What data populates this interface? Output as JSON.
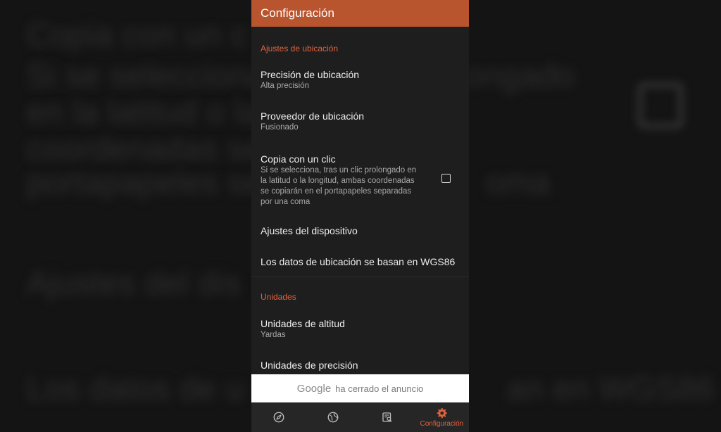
{
  "appbar": {
    "title": "Configuración"
  },
  "sections": {
    "location": {
      "header": "Ajustes de ubicación",
      "precision": {
        "title": "Precisión de ubicación",
        "summary": "Alta precisión"
      },
      "provider": {
        "title": "Proveedor de ubicación",
        "summary": "Fusionado"
      },
      "one_click_copy": {
        "title": "Copia con un clic",
        "summary": "Si se selecciona, tras un clic prolongado en la latitud o la longitud, ambas coordenadas se copiarán en el portapapeles separadas por una coma",
        "checked": false
      },
      "device_settings": {
        "title": "Ajustes del dispositivo"
      },
      "wgs": {
        "title": "Los datos de ubicación se basan en WGS86"
      }
    },
    "units": {
      "header": "Unidades",
      "altitude": {
        "title": "Unidades de altitud",
        "summary": "Yardas"
      },
      "precision_units": {
        "title": "Unidades de precisión"
      }
    }
  },
  "ad_banner": {
    "brand": "Google",
    "text": "ha cerrado el anuncio"
  },
  "navbar": {
    "tabs": [
      {
        "icon": "compass-icon"
      },
      {
        "icon": "globe-icon"
      },
      {
        "icon": "log-search-icon"
      },
      {
        "icon": "gear-icon",
        "label": "Configuración",
        "active": true
      }
    ]
  },
  "background_echo": {
    "line1": "Copia con un c",
    "line2": "Si se selecciona,",
    "line2b": "ongado",
    "line3": "en la latitud o la l",
    "line4": "coordenadas se c",
    "line5": "portapapeles sep",
    "line5b": "oma",
    "line6": "Ajustes del dis",
    "line7": "Los datos de u",
    "line7b": "an en WGS86"
  },
  "colors": {
    "accent": "#e0623f",
    "appbar": "#b8552f",
    "surface": "#1e1e1e"
  }
}
